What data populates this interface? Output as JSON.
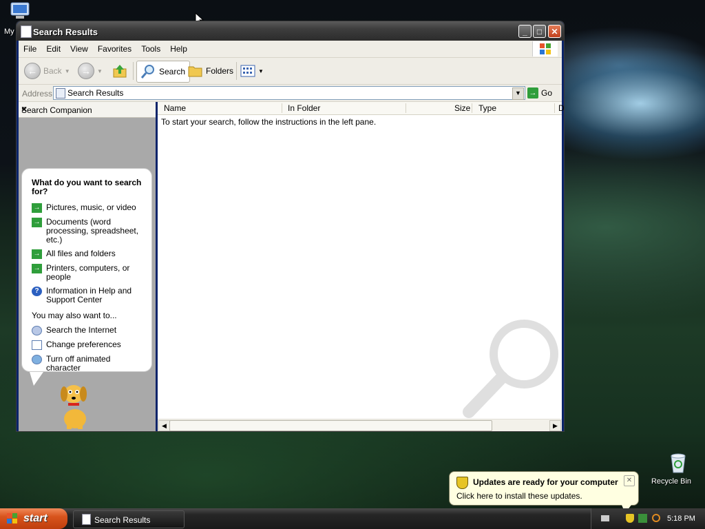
{
  "desktop": {
    "icons": [
      {
        "label": "My"
      },
      {
        "label": "Recycle Bin"
      }
    ]
  },
  "window": {
    "title": "Search Results",
    "menu": [
      "File",
      "Edit",
      "View",
      "Favorites",
      "Tools",
      "Help"
    ],
    "toolbar": {
      "back_label": "Back",
      "search_label": "Search",
      "folders_label": "Folders"
    },
    "address": {
      "label": "Address",
      "value": "Search Results",
      "go_label": "Go"
    },
    "search_companion": {
      "header": "Search Companion",
      "question": "What do you want to search for?",
      "options": [
        {
          "label": "Pictures, music, or video",
          "icon": "green-arrow-icon"
        },
        {
          "label": "Documents (word processing, spreadsheet, etc.)",
          "icon": "green-arrow-icon"
        },
        {
          "label": "All files and folders",
          "icon": "green-arrow-icon"
        },
        {
          "label": "Printers, computers, or people",
          "icon": "green-arrow-icon"
        },
        {
          "label": "Information in Help and Support Center",
          "icon": "help-icon"
        }
      ],
      "also_label": "You may also want to...",
      "also_options": [
        {
          "label": "Search the Internet",
          "icon": "search-internet-icon"
        },
        {
          "label": "Change preferences",
          "icon": "preferences-icon"
        },
        {
          "label": "Turn off animated character",
          "icon": "animated-character-icon"
        }
      ]
    },
    "results": {
      "columns": [
        "Name",
        "In Folder",
        "Size",
        "Type",
        "D"
      ],
      "message": "To start your search, follow the instructions in the left pane."
    }
  },
  "notification": {
    "title": "Updates are ready for your computer",
    "message": "Click here to install these updates."
  },
  "taskbar": {
    "start_label": "start",
    "task_label": "Search Results",
    "clock": "5:18 PM"
  }
}
